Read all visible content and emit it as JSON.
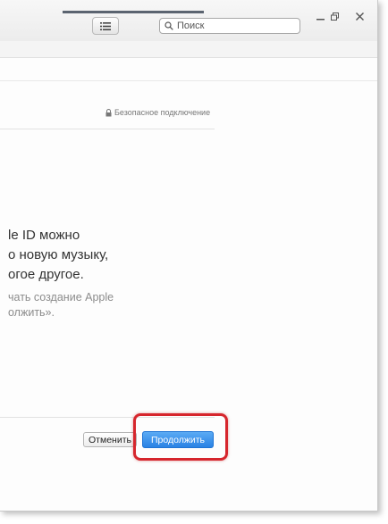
{
  "window": {
    "search_placeholder": "Поиск",
    "list_icon": "list-icon",
    "search_icon": "search-icon",
    "minimize_icon": "minimize-icon",
    "restore_icon": "restore-icon",
    "close_icon": "close-icon"
  },
  "content": {
    "secure_label": "Безопасное подключение",
    "lock_icon": "lock-icon",
    "main_lines": [
      "le ID можно",
      "о новую музыку,",
      "огое другое."
    ],
    "sub_lines": [
      "чать создание Apple",
      "олжить»."
    ]
  },
  "buttons": {
    "cancel_label": "Отменить",
    "continue_label": "Продолжить"
  },
  "colors": {
    "accent": "#2a82e4",
    "highlight": "#d6262d"
  }
}
